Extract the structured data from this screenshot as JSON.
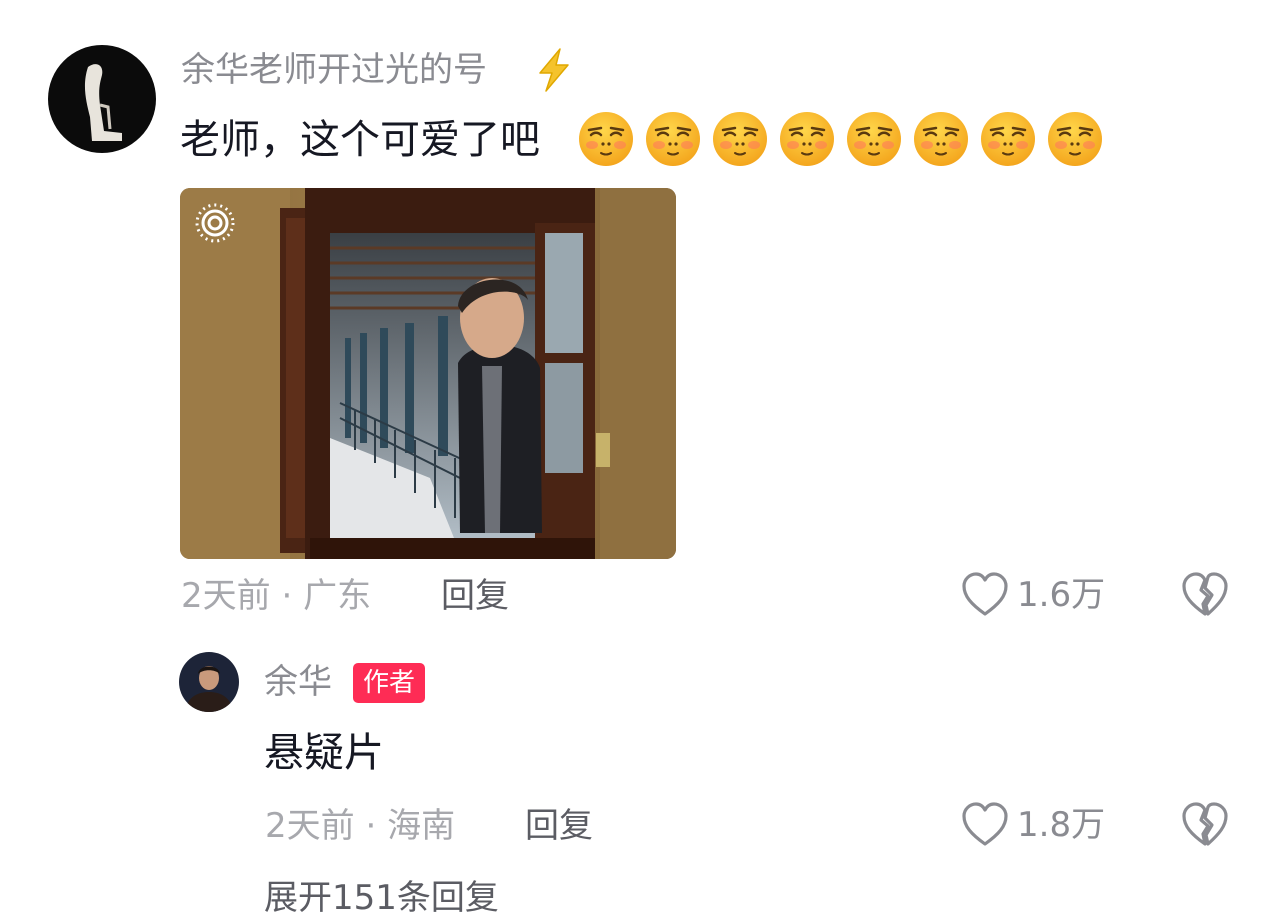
{
  "comment": {
    "username": "余华老师开过光的号",
    "text": "老师，这个可爱了吧",
    "emoji_name": "smug-blush-emoji",
    "emoji_count": 8,
    "time": "2天前",
    "separator": "·",
    "location": "广东",
    "reply_label": "回复",
    "likes": "1.6万"
  },
  "reply": {
    "username": "余华",
    "badge": "作者",
    "text": "悬疑片",
    "time": "2天前",
    "separator": "·",
    "location": "海南",
    "reply_label": "回复",
    "likes": "1.8万"
  },
  "expand_replies": "展开151条回复",
  "colors": {
    "badge": "#fe2c55",
    "muted_text": "#a7a8ad",
    "username_text": "#8a8b91",
    "primary_text": "#161823",
    "bolt": "#f5c32c"
  },
  "icons": {
    "verified": "lightning-bolt-icon",
    "like": "heart-outline-icon",
    "dislike": "broken-heart-icon",
    "media_badge": "live-photo-icon"
  }
}
